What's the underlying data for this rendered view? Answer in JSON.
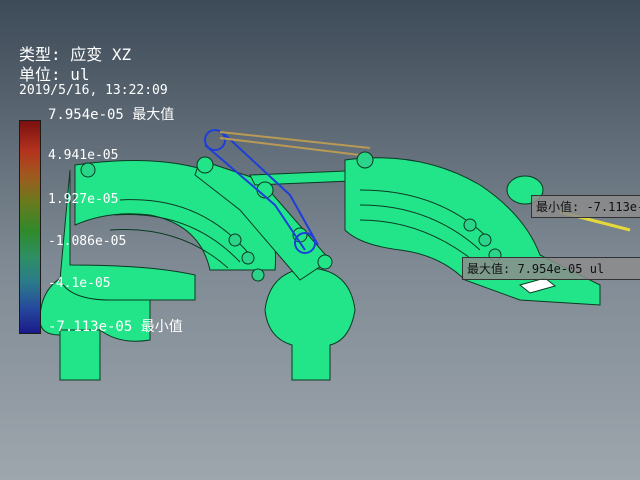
{
  "header": {
    "type_line": "类型: 应变 XZ",
    "unit_line": "单位: ul",
    "timestamp": "2019/5/16, 13:22:09"
  },
  "legend": {
    "max_label": "7.954e-05 最大值",
    "ticks": [
      "4.941e-05",
      "1.927e-05",
      "-1.086e-05",
      "-4.1e-05"
    ],
    "min_label": "-7.113e-05 最小值",
    "colors": [
      "#7a1010",
      "#b3321d",
      "#6a7a1c",
      "#2f8a2b",
      "#2b7b8a",
      "#1a1a8a"
    ]
  },
  "probes": {
    "min": "最小值: -7.113e-",
    "max": "最大值: 7.954e-05 ul"
  },
  "model_color": "#22e58a"
}
